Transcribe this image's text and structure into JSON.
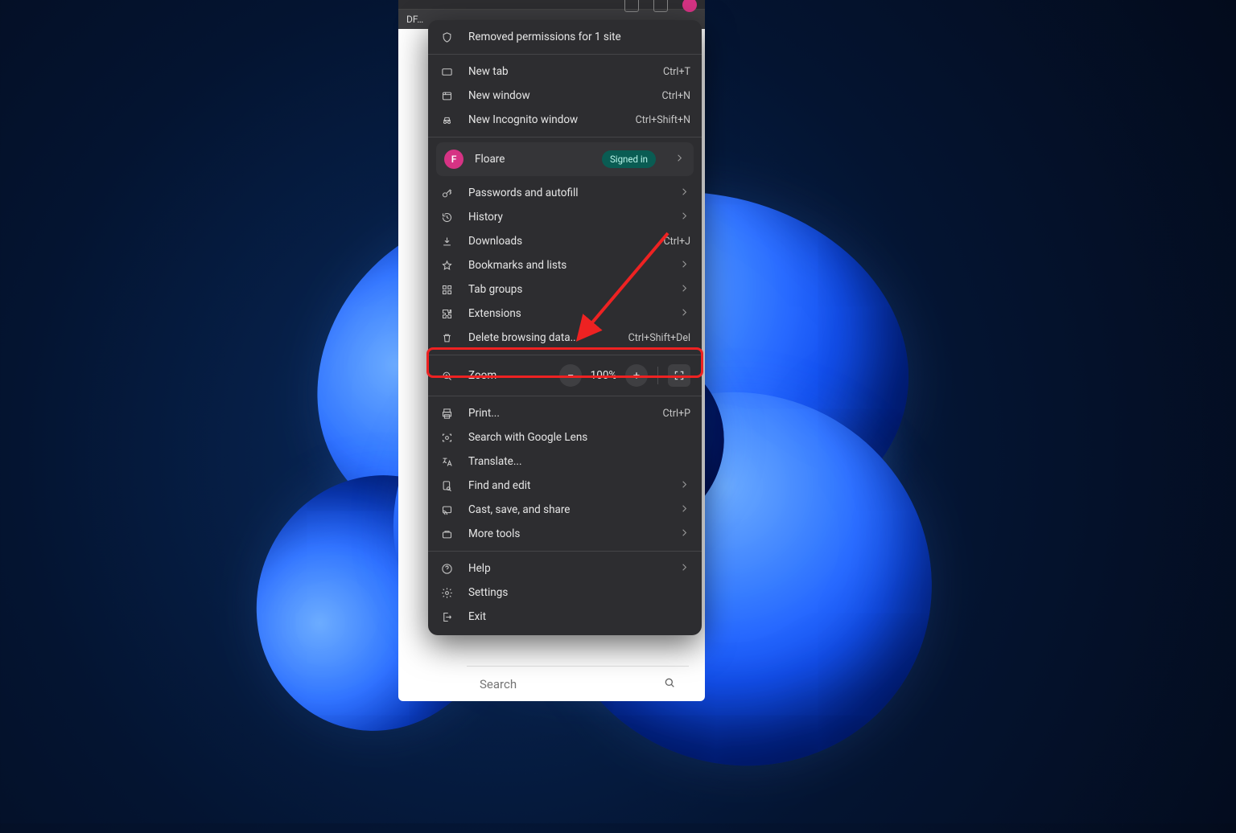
{
  "tab_fragment": "DF…",
  "banner": {
    "text": "Removed permissions for 1 site"
  },
  "sections": [
    [
      {
        "id": "new-tab",
        "icon": "tab-icon",
        "label": "New tab",
        "accel": "Ctrl+T"
      },
      {
        "id": "new-window",
        "icon": "window-icon",
        "label": "New window",
        "accel": "Ctrl+N"
      },
      {
        "id": "incognito",
        "icon": "incognito-icon",
        "label": "New Incognito window",
        "accel": "Ctrl+Shift+N"
      }
    ]
  ],
  "profile": {
    "initial": "F",
    "name": "Floare",
    "status": "Signed in"
  },
  "group2": [
    {
      "id": "passwords",
      "icon": "key-icon",
      "label": "Passwords and autofill",
      "sub": true
    },
    {
      "id": "history",
      "icon": "history-icon",
      "label": "History",
      "sub": true
    },
    {
      "id": "downloads",
      "icon": "download-icon",
      "label": "Downloads",
      "accel": "Ctrl+J"
    },
    {
      "id": "bookmarks",
      "icon": "star-icon",
      "label": "Bookmarks and lists",
      "sub": true
    },
    {
      "id": "tabgroups",
      "icon": "grid-icon",
      "label": "Tab groups",
      "sub": true
    },
    {
      "id": "extensions",
      "icon": "puzzle-icon",
      "label": "Extensions",
      "sub": true
    },
    {
      "id": "delete",
      "icon": "trash-icon",
      "label": "Delete browsing data...",
      "accel": "Ctrl+Shift+Del"
    }
  ],
  "zoom": {
    "label": "Zoom",
    "value": "100%"
  },
  "group3": [
    {
      "id": "print",
      "icon": "print-icon",
      "label": "Print...",
      "accel": "Ctrl+P"
    },
    {
      "id": "lens",
      "icon": "lens-icon",
      "label": "Search with Google Lens"
    },
    {
      "id": "translate",
      "icon": "translate-icon",
      "label": "Translate..."
    },
    {
      "id": "find",
      "icon": "find-icon",
      "label": "Find and edit",
      "sub": true
    },
    {
      "id": "cast",
      "icon": "cast-icon",
      "label": "Cast, save, and share",
      "sub": true
    },
    {
      "id": "moretools",
      "icon": "tools-icon",
      "label": "More tools",
      "sub": true
    }
  ],
  "group4": [
    {
      "id": "help",
      "icon": "help-icon",
      "label": "Help",
      "sub": true
    },
    {
      "id": "settings",
      "icon": "gear-icon",
      "label": "Settings"
    },
    {
      "id": "exit",
      "icon": "exit-icon",
      "label": "Exit"
    }
  ],
  "search_placeholder": "Search",
  "annotation": {
    "highlighted_item": "delete"
  }
}
